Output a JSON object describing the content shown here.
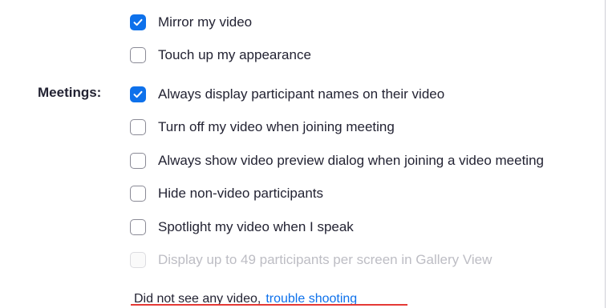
{
  "video_options": [
    {
      "label": "Mirror my video",
      "checked": true,
      "disabled": false
    },
    {
      "label": "Touch up my appearance",
      "checked": false,
      "disabled": false
    }
  ],
  "meetings": {
    "section_label": "Meetings:",
    "options": [
      {
        "label": "Always display participant names on their video",
        "checked": true,
        "disabled": false
      },
      {
        "label": "Turn off my video when joining meeting",
        "checked": false,
        "disabled": false
      },
      {
        "label": "Always show video preview dialog when joining a video meeting",
        "checked": false,
        "disabled": false
      },
      {
        "label": "Hide non-video participants",
        "checked": false,
        "disabled": false
      },
      {
        "label": "Spotlight my video when I speak",
        "checked": false,
        "disabled": false
      },
      {
        "label": "Display up to 49 participants per screen in Gallery View",
        "checked": false,
        "disabled": true
      }
    ]
  },
  "footer": {
    "text": "Did not see any video,",
    "link": "trouble shooting"
  },
  "colors": {
    "accent": "#0e71eb",
    "annotation_underline": "#e53935"
  }
}
